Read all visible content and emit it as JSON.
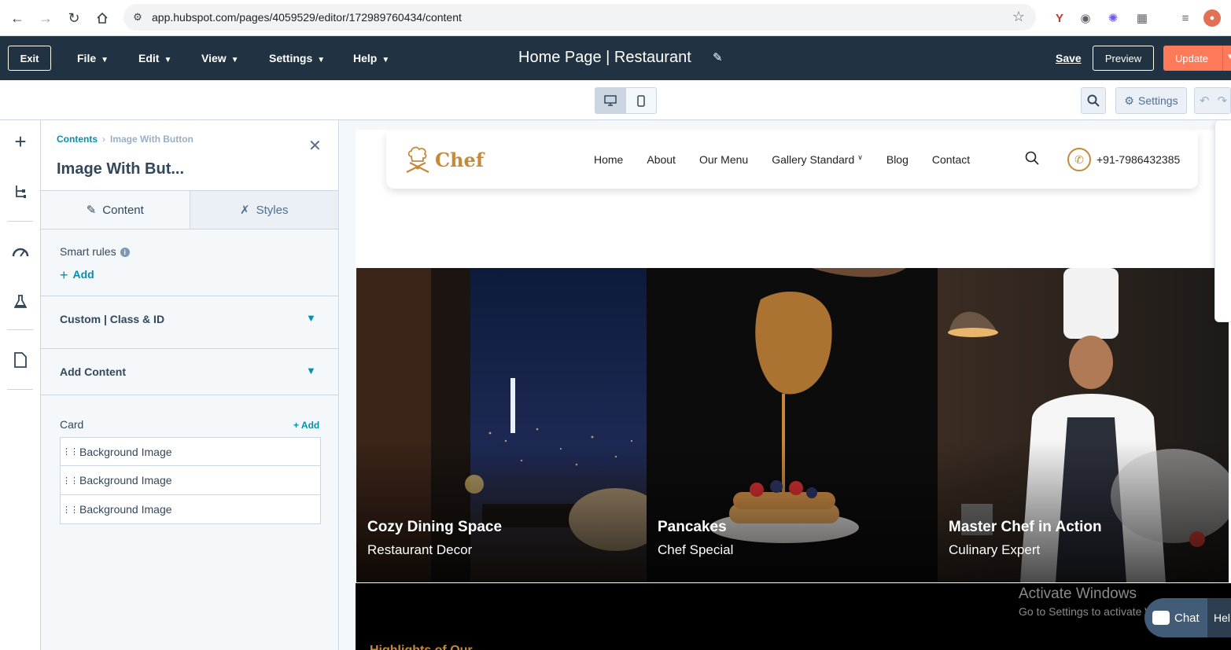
{
  "browser": {
    "url": "app.hubspot.com/pages/4059529/editor/172989760434/content"
  },
  "header": {
    "exit_label": "Exit",
    "menu": [
      "File",
      "Edit",
      "View",
      "Settings",
      "Help"
    ],
    "page_title": "Home Page | Restaurant",
    "save_label": "Save",
    "preview_label": "Preview",
    "update_label": "Update"
  },
  "toolbar": {
    "settings_label": "Settings",
    "active_device": "desktop"
  },
  "panel": {
    "breadcrumb_root": "Contents",
    "breadcrumb_current": "Image With Button",
    "module_title": "Image With But...",
    "tab_content": "Content",
    "tab_styles": "Styles",
    "smart_rules_label": "Smart rules",
    "add_label": "Add",
    "sections": [
      "Custom | Class & ID",
      "Add Content"
    ],
    "card_label": "Card",
    "card_add_label": "+ Add",
    "card_items": [
      "Background Image",
      "Background Image",
      "Background Image"
    ]
  },
  "site": {
    "logo_text": "Chef",
    "nav_links": [
      "Home",
      "About",
      "Our Menu",
      "Gallery Standard",
      "Blog",
      "Contact"
    ],
    "phone": "+91-7986432385",
    "cards": [
      {
        "title": "Cozy Dining Space",
        "subtitle": "Restaurant Decor"
      },
      {
        "title": "Pancakes",
        "subtitle": "Chef Special"
      },
      {
        "title": "Master Chef in Action",
        "subtitle": "Culinary Expert"
      }
    ],
    "next_section_peek": "Highlights of Our ..."
  },
  "overlay": {
    "watermark_line1": "Activate Windows",
    "watermark_line2": "Go to Settings to activate Windows.",
    "chat_label": "Chat",
    "help_label": "Hel"
  },
  "colors": {
    "hubspot_navy": "#213343",
    "update_orange": "#ff7a59",
    "link_teal": "#0091ae",
    "brand_gold": "#c48a3a"
  }
}
